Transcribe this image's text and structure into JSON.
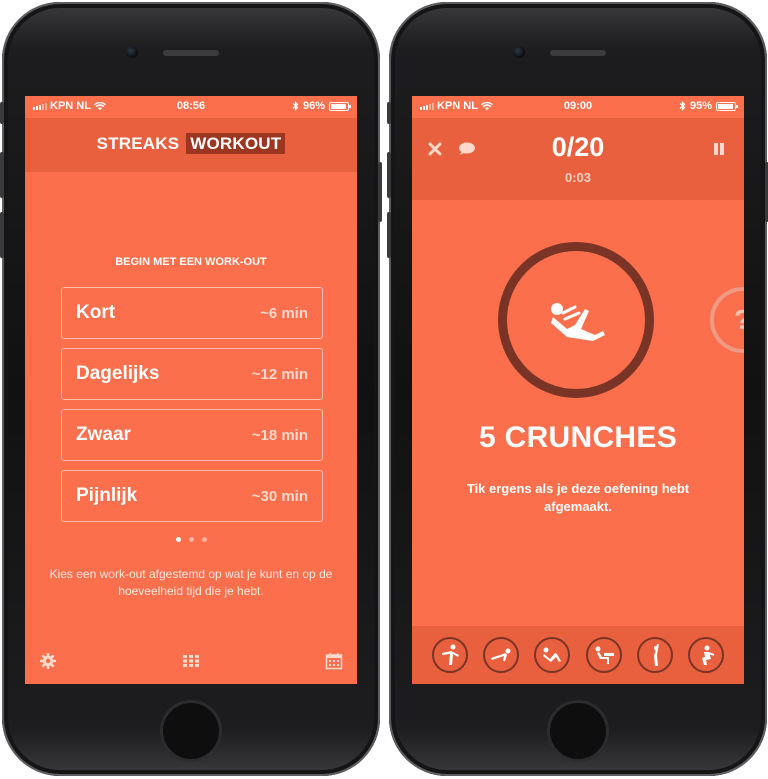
{
  "left_screen": {
    "status": {
      "carrier": "KPN NL",
      "time": "08:56",
      "battery": "96%",
      "battery_level": 0.96
    },
    "brand": {
      "word1": "STREAKS",
      "word2": "WORKOUT"
    },
    "section_title": "BEGIN MET EEN WORK-OUT",
    "options": [
      {
        "name": "Kort",
        "duration": "~6 min"
      },
      {
        "name": "Dagelijks",
        "duration": "~12 min"
      },
      {
        "name": "Zwaar",
        "duration": "~18 min"
      },
      {
        "name": "Pijnlijk",
        "duration": "~30 min"
      }
    ],
    "pager": {
      "count": 3,
      "active": 1
    },
    "hint": "Kies een work-out afgestemd op wat je kunt en op de hoeveelheid tijd die je hebt.",
    "toolbar_icons": [
      "gear-icon",
      "grid-icon",
      "calendar-icon"
    ]
  },
  "right_screen": {
    "status": {
      "carrier": "KPN NL",
      "time": "09:00",
      "battery": "95%",
      "battery_level": 0.95
    },
    "counter": "0/20",
    "timer": "0:03",
    "next_hint": "?",
    "exercise": "5 CRUNCHES",
    "instruction": "Tik ergens als je deze oefening hebt afgemaakt.",
    "header_icons": [
      "close-icon",
      "chat-bubble-icon",
      "pause-icon"
    ],
    "exercise_icons": [
      "kick-icon",
      "pushup-icon",
      "situp-icon",
      "dip-icon",
      "stretch-icon",
      "squat-icon"
    ]
  },
  "colors": {
    "primary": "#fb6f4c",
    "header": "#e9603f",
    "dark_accent": "#7a3426"
  }
}
